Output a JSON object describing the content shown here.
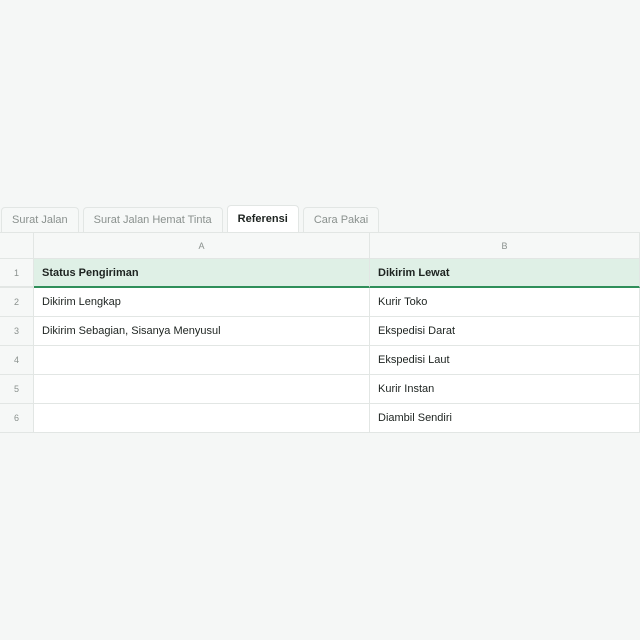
{
  "tabs": [
    {
      "label": "Surat Jalan",
      "active": false
    },
    {
      "label": "Surat Jalan Hemat Tinta",
      "active": false
    },
    {
      "label": "Referensi",
      "active": true
    },
    {
      "label": "Cara Pakai",
      "active": false
    }
  ],
  "columns": [
    "A",
    "B"
  ],
  "rows": [
    {
      "num": "1",
      "a": "Status Pengiriman",
      "b": "Dikirim Lewat"
    },
    {
      "num": "2",
      "a": "Dikirim Lengkap",
      "b": "Kurir Toko"
    },
    {
      "num": "3",
      "a": "Dikirim Sebagian, Sisanya Menyusul",
      "b": "Ekspedisi Darat"
    },
    {
      "num": "4",
      "a": "",
      "b": "Ekspedisi Laut"
    },
    {
      "num": "5",
      "a": "",
      "b": "Kurir Instan"
    },
    {
      "num": "6",
      "a": "",
      "b": "Diambil Sendiri"
    }
  ],
  "colors": {
    "header_fill": "#dff0e6",
    "header_border": "#2f8f5a"
  }
}
